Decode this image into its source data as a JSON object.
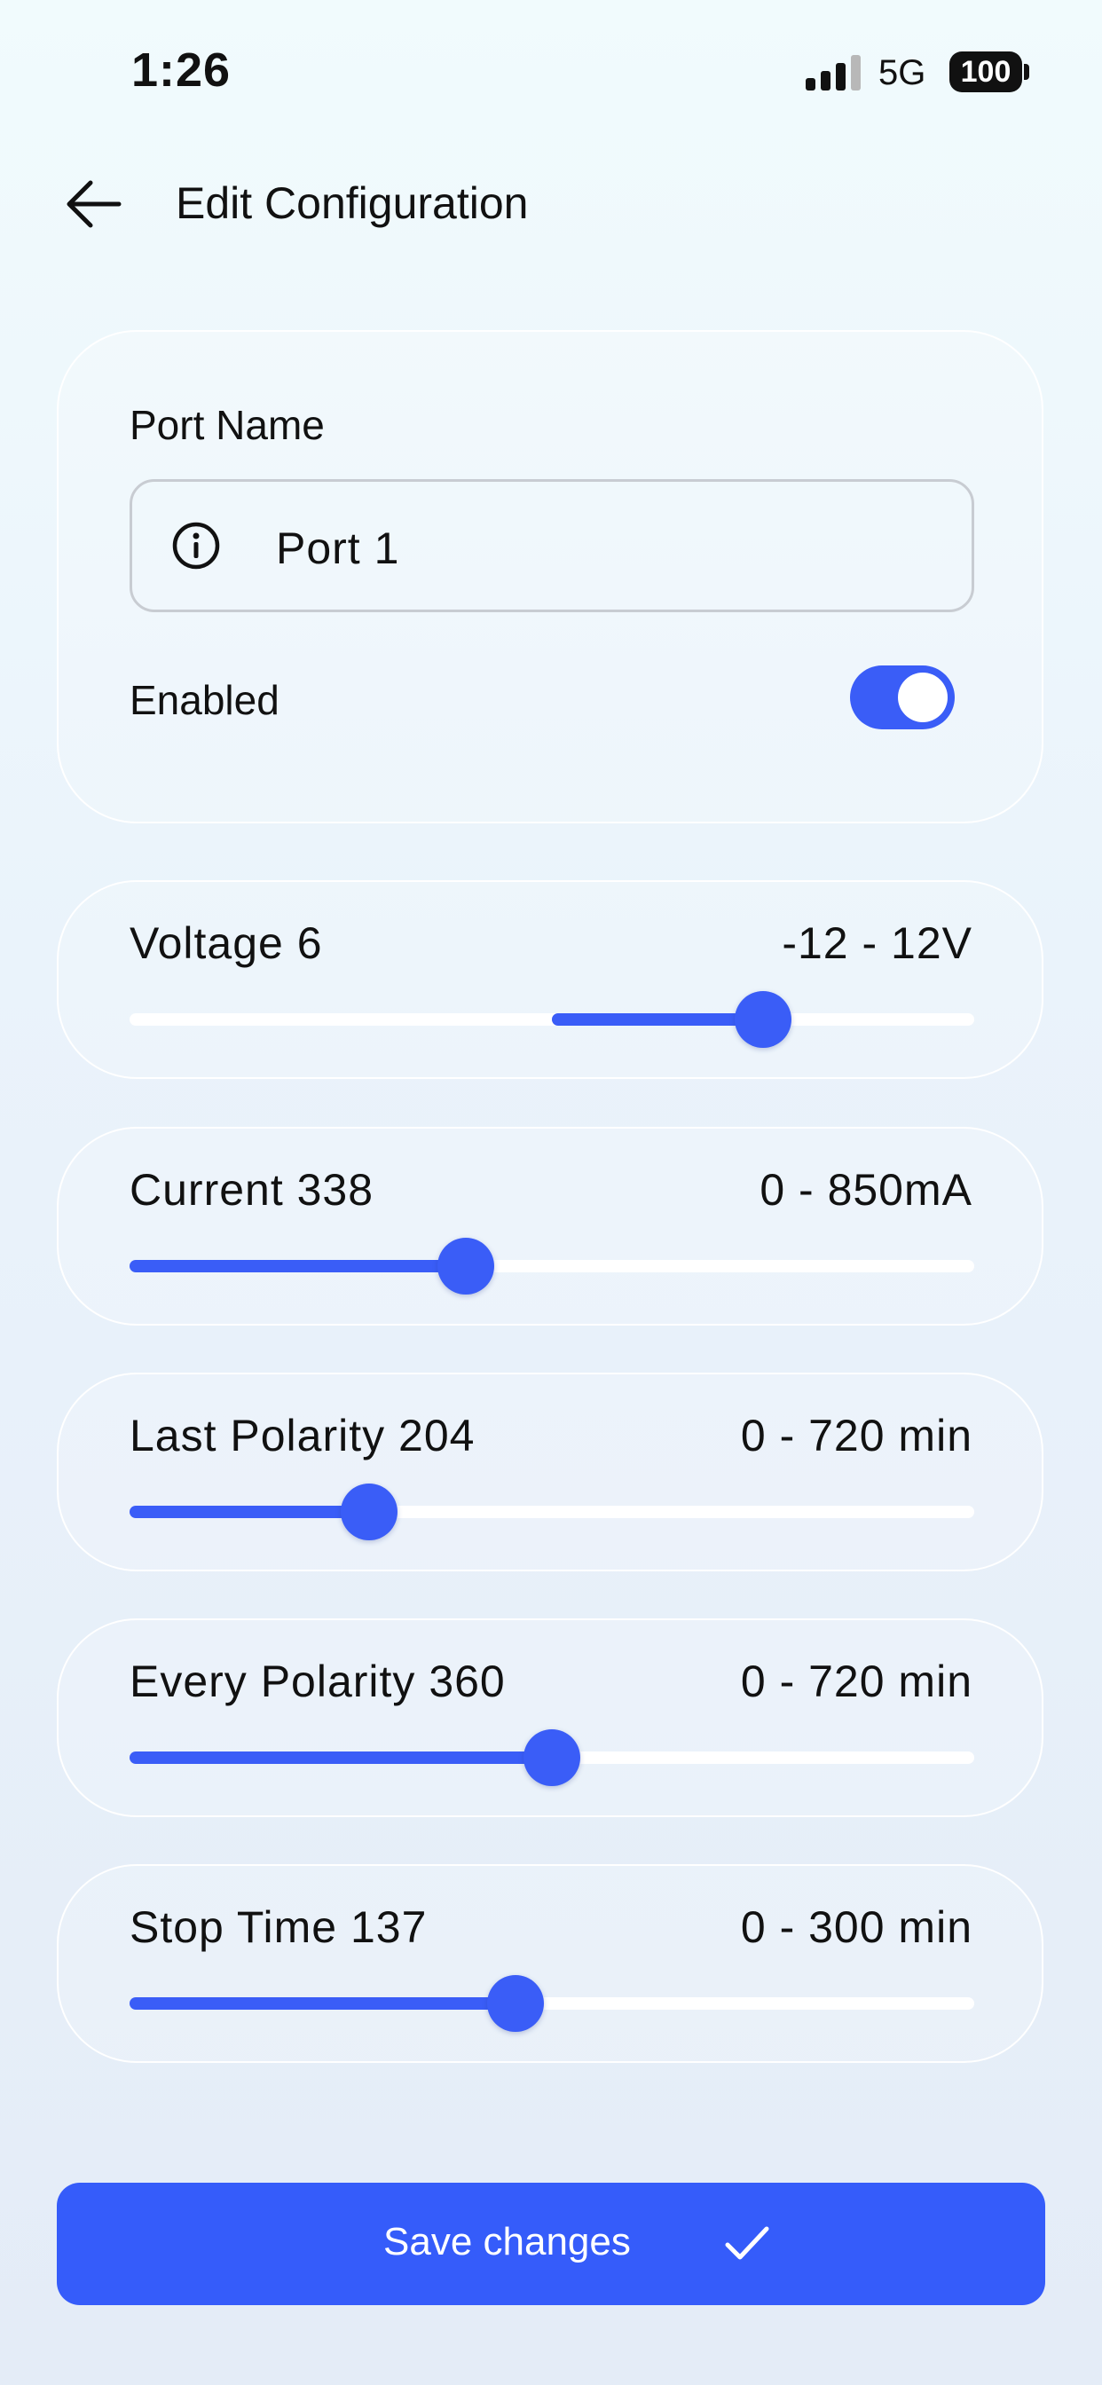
{
  "status_bar": {
    "time": "1:26",
    "network": "5G",
    "battery": "100"
  },
  "header": {
    "title": "Edit Configuration",
    "back_icon": "arrow-left-icon"
  },
  "port": {
    "name_label": "Port Name",
    "name_value": "Port 1",
    "info_icon": "info-icon",
    "enabled_label": "Enabled",
    "enabled": true
  },
  "colors": {
    "accent": "#3a5df7",
    "button": "#355cfa",
    "track": "#ffffff"
  },
  "sliders": [
    {
      "label": "Voltage 6",
      "range": "-12 - 12V",
      "min": -12,
      "max": 12,
      "value": 6,
      "center_fill": true
    },
    {
      "label": "Current 338",
      "range": "0 - 850mA",
      "min": 0,
      "max": 850,
      "value": 338,
      "center_fill": false
    },
    {
      "label": "Last Polarity 204",
      "range": "0 - 720 min",
      "min": 0,
      "max": 720,
      "value": 204,
      "center_fill": false
    },
    {
      "label": "Every Polarity 360",
      "range": "0 - 720 min",
      "min": 0,
      "max": 720,
      "value": 360,
      "center_fill": false
    },
    {
      "label": "Stop Time 137",
      "range": "0 - 300 min",
      "min": 0,
      "max": 300,
      "value": 137,
      "center_fill": false
    }
  ],
  "save_button": {
    "label": "Save changes",
    "icon": "check-icon"
  }
}
